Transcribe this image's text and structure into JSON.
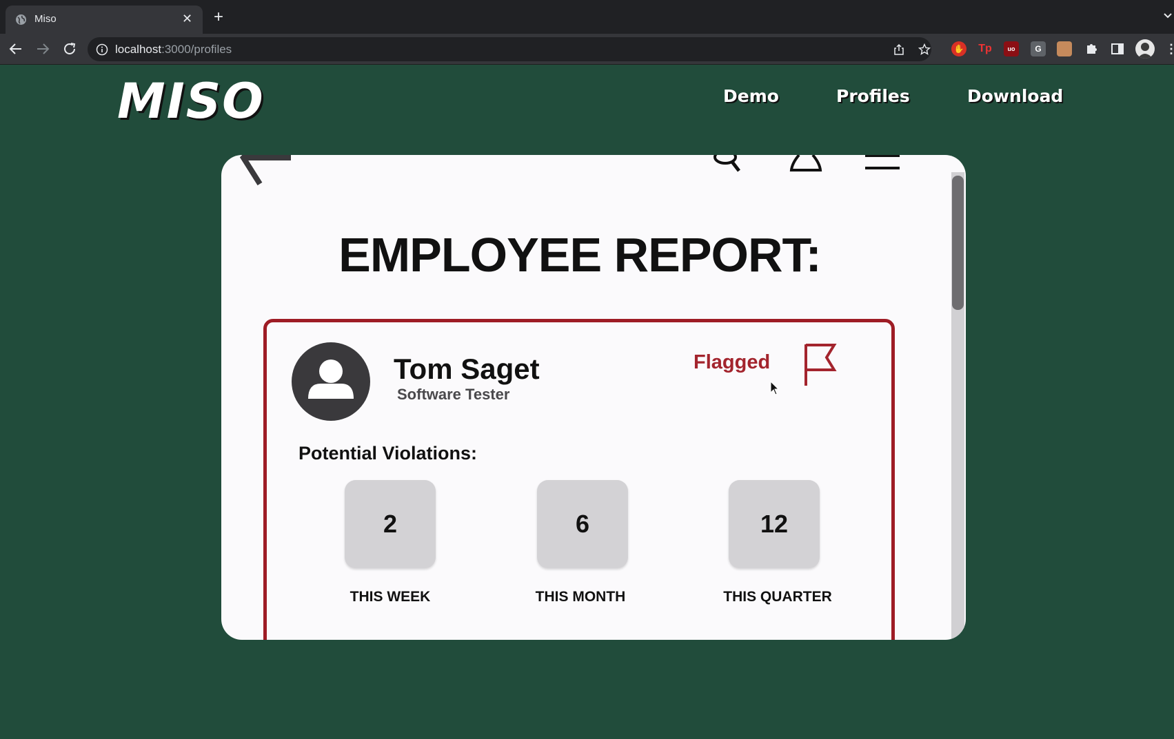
{
  "browser": {
    "tab_title": "Miso",
    "url_host": "localhost",
    "url_path": ":3000/profiles"
  },
  "site": {
    "logo": "MISO",
    "nav": [
      "Demo",
      "Profiles",
      "Download"
    ]
  },
  "report": {
    "title": "EMPLOYEE REPORT:",
    "employee": {
      "name": "Tom Saget",
      "role": "Software Tester",
      "status": "Flagged"
    },
    "violations_label": "Potential Violations:",
    "stats": [
      {
        "value": "2",
        "label": "THIS WEEK"
      },
      {
        "value": "6",
        "label": "THIS MONTH"
      },
      {
        "value": "12",
        "label": "THIS QUARTER"
      }
    ]
  },
  "colors": {
    "page_bg": "#214c3b",
    "accent_red": "#9e1c25",
    "stat_box": "#d3d2d5"
  }
}
